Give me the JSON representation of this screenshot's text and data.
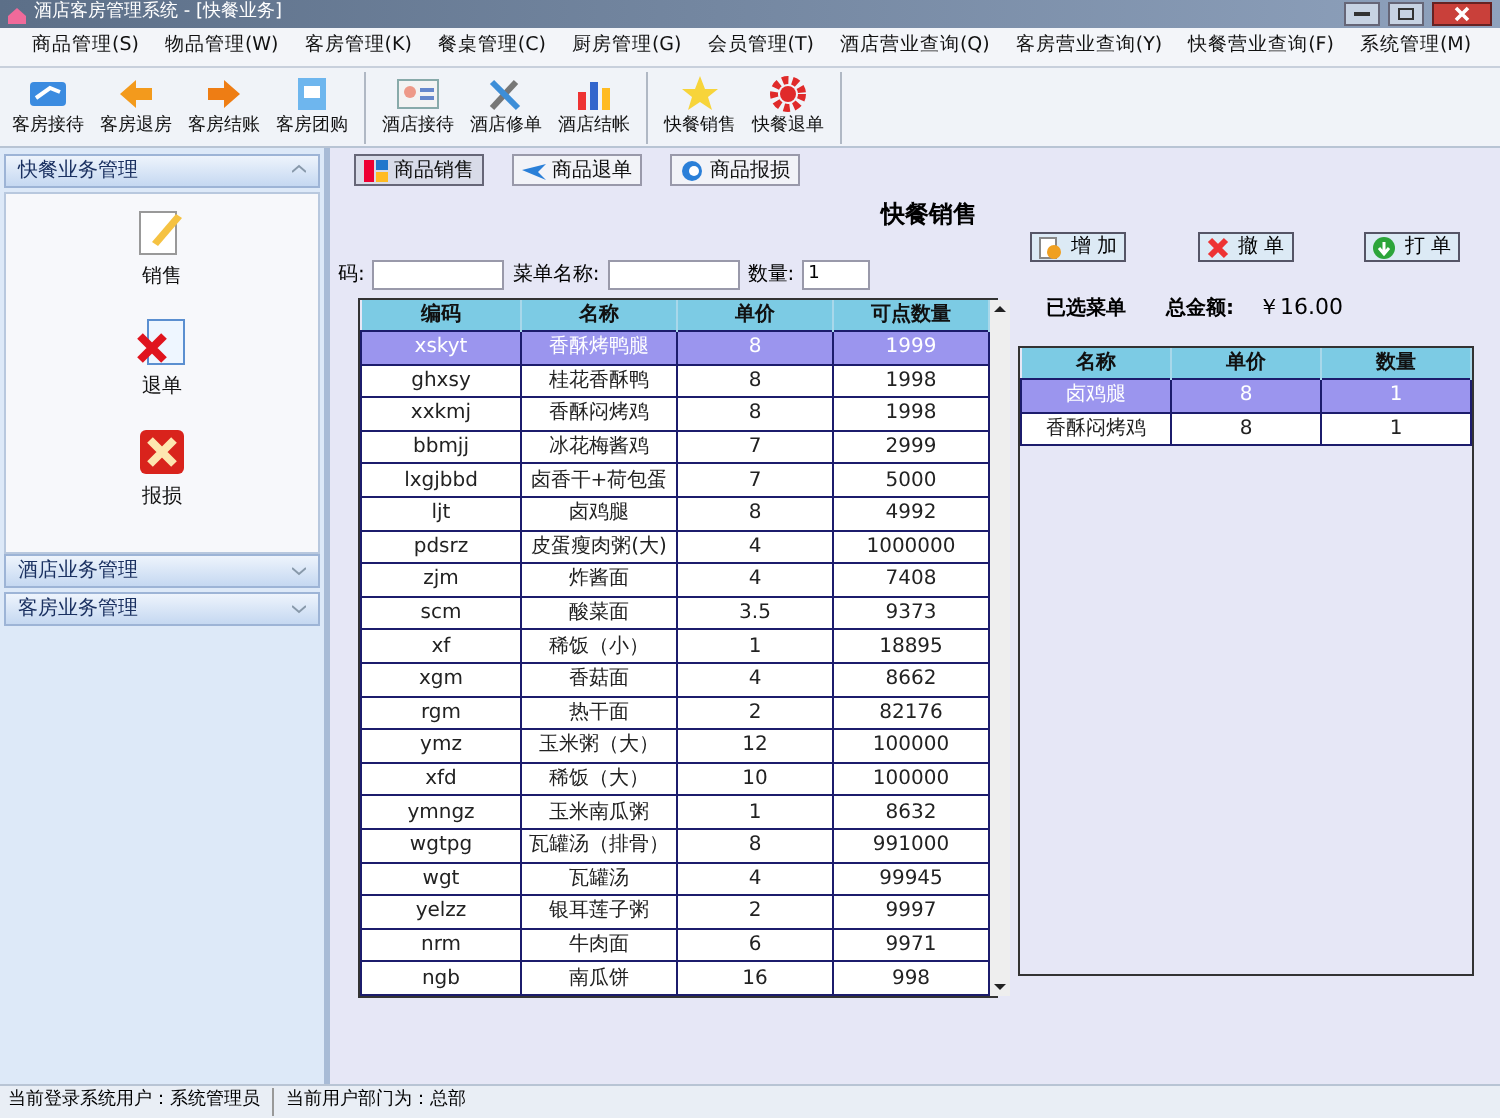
{
  "window": {
    "title": "酒店客房管理系统 - [快餐业务]"
  },
  "menu": [
    "商品管理(S)",
    "物品管理(W)",
    "客房管理(K)",
    "餐桌管理(C)",
    "厨房管理(G)",
    "会员管理(T)",
    "酒店营业查询(Q)",
    "客房营业查询(Y)",
    "快餐营业查询(F)",
    "系统管理(M)"
  ],
  "toolbar": [
    [
      "客房接待",
      "客房退房",
      "客房结账",
      "客房团购"
    ],
    [
      "酒店接待",
      "酒店修单",
      "酒店结帐"
    ],
    [
      "快餐销售",
      "快餐退单"
    ]
  ],
  "sidebar": [
    {
      "title": "快餐业务管理",
      "expanded": true,
      "items": [
        "销售",
        "退单",
        "报损"
      ]
    },
    {
      "title": "酒店业务管理",
      "expanded": false
    },
    {
      "title": "客房业务管理",
      "expanded": false
    }
  ],
  "tabs": [
    {
      "label": "商品销售",
      "selected": true
    },
    {
      "label": "商品退单",
      "selected": false
    },
    {
      "label": "商品报损",
      "selected": false
    }
  ],
  "page_title": "快餐销售",
  "filters": [
    {
      "label": "码:"
    },
    {
      "label": "菜单名称:"
    },
    {
      "label": "数量:",
      "value": "1"
    }
  ],
  "actions": [
    "增 加",
    "撤 单",
    "打 单"
  ],
  "menu_table": {
    "columns": [
      "编码",
      "名称",
      "单价",
      "可点数量"
    ],
    "rows": [
      {
        "cells": [
          "xskyt",
          "香酥烤鸭腿",
          "8",
          "1999"
        ],
        "selected": true
      },
      {
        "cells": [
          "ghxsy",
          "桂花香酥鸭",
          "8",
          "1998"
        ],
        "selected": false
      },
      {
        "cells": [
          "xxkmj",
          "香酥闷烤鸡",
          "8",
          "1998"
        ],
        "selected": false
      },
      {
        "cells": [
          "bbmjj",
          "冰花梅酱鸡",
          "7",
          "2999"
        ],
        "selected": false
      },
      {
        "cells": [
          "lxgjbbd",
          "卤香干+荷包蛋",
          "7",
          "5000"
        ],
        "selected": false
      },
      {
        "cells": [
          "ljt",
          "卤鸡腿",
          "8",
          "4992"
        ],
        "selected": false
      },
      {
        "cells": [
          "pdsrz",
          "皮蛋瘦肉粥(大)",
          "4",
          "1000000"
        ],
        "selected": false
      },
      {
        "cells": [
          "zjm",
          "炸酱面",
          "4",
          "7408"
        ],
        "selected": false
      },
      {
        "cells": [
          "scm",
          "酸菜面",
          "3.5",
          "9373"
        ],
        "selected": false
      },
      {
        "cells": [
          "xf",
          "稀饭（小）",
          "1",
          "18895"
        ],
        "selected": false
      },
      {
        "cells": [
          "xgm",
          "香菇面",
          "4",
          "8662"
        ],
        "selected": false
      },
      {
        "cells": [
          "rgm",
          "热干面",
          "2",
          "82176"
        ],
        "selected": false
      },
      {
        "cells": [
          "ymz",
          "玉米粥（大）",
          "12",
          "100000"
        ],
        "selected": false
      },
      {
        "cells": [
          "xfd",
          "稀饭（大）",
          "10",
          "100000"
        ],
        "selected": false
      },
      {
        "cells": [
          "ymngz",
          "玉米南瓜粥",
          "1",
          "8632"
        ],
        "selected": false
      },
      {
        "cells": [
          "wgtpg",
          "瓦罐汤（排骨）",
          "8",
          "991000"
        ],
        "selected": false
      },
      {
        "cells": [
          "wgt",
          "瓦罐汤",
          "4",
          "99945"
        ],
        "selected": false
      },
      {
        "cells": [
          "yelzz",
          "银耳莲子粥",
          "2",
          "9997"
        ],
        "selected": false
      },
      {
        "cells": [
          "nrm",
          "牛肉面",
          "6",
          "9971"
        ],
        "selected": false
      },
      {
        "cells": [
          "ngb",
          "南瓜饼",
          "16",
          "998"
        ],
        "selected": false
      }
    ]
  },
  "summary": {
    "label": "已选菜单",
    "total_label": "总金额:",
    "total": "￥16.00"
  },
  "order_table": {
    "columns": [
      "名称",
      "单价",
      "数量"
    ],
    "rows": [
      {
        "cells": [
          "卤鸡腿",
          "8",
          "1"
        ],
        "selected": true
      },
      {
        "cells": [
          "香酥闷烤鸡",
          "8",
          "1"
        ],
        "selected": false
      }
    ]
  },
  "status_bar": [
    "当前登录系统用户：系统管理员",
    "当前用户部门为：总部"
  ]
}
